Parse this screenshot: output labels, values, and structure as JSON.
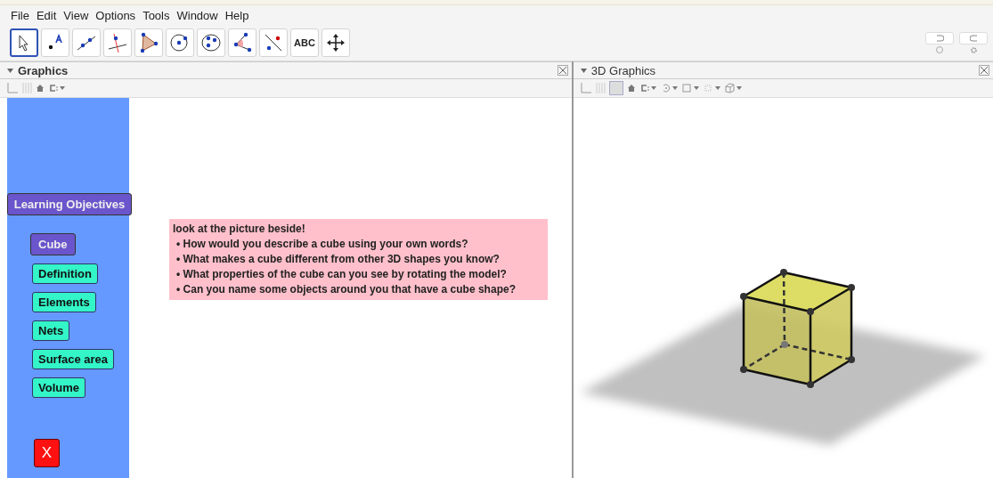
{
  "menu": [
    "File",
    "Edit",
    "View",
    "Options",
    "Tools",
    "Window",
    "Help"
  ],
  "tools": [
    {
      "kind": "move",
      "selected": true
    },
    {
      "kind": "point",
      "selected": false
    },
    {
      "kind": "line",
      "selected": false
    },
    {
      "kind": "perpendicular",
      "selected": false
    },
    {
      "kind": "polygon",
      "selected": false
    },
    {
      "kind": "circle",
      "selected": false
    },
    {
      "kind": "conic",
      "selected": false
    },
    {
      "kind": "angle",
      "selected": false
    },
    {
      "kind": "reflect",
      "selected": false
    },
    {
      "kind": "text",
      "selected": false,
      "label": "ABC"
    },
    {
      "kind": "pan",
      "selected": false
    }
  ],
  "graphics": {
    "title": "Graphics",
    "toolbar": [
      {
        "kind": "axes"
      },
      {
        "kind": "grid"
      },
      {
        "kind": "home"
      },
      {
        "kind": "style"
      }
    ],
    "sidebar": [
      {
        "kind": "heading",
        "label": "Learning Objectives"
      },
      {
        "kind": "topic",
        "label": "Cube"
      },
      {
        "kind": "item",
        "label": "Definition"
      },
      {
        "kind": "item",
        "label": "Elements"
      },
      {
        "kind": "item",
        "label": "Nets"
      },
      {
        "kind": "item",
        "label": "Surface area"
      },
      {
        "kind": "item",
        "label": "Volume"
      },
      {
        "kind": "close",
        "label": "X"
      }
    ],
    "textbox": {
      "title": "look at the picture beside!",
      "bullets": [
        "• How would you describe a cube using your own words?",
        "• What makes a cube different from other 3D shapes you know?",
        "• What properties of the cube can you see by rotating the model?",
        "• Can you name some objects around you that have a cube shape?"
      ]
    }
  },
  "graphics3d": {
    "title": "3D Graphics",
    "toolbar": [
      {
        "kind": "axes"
      },
      {
        "kind": "grid"
      },
      {
        "kind": "plane"
      },
      {
        "kind": "home"
      },
      {
        "kind": "style"
      },
      {
        "kind": "rotate"
      },
      {
        "kind": "view"
      },
      {
        "kind": "clipping"
      },
      {
        "kind": "box"
      }
    ]
  }
}
